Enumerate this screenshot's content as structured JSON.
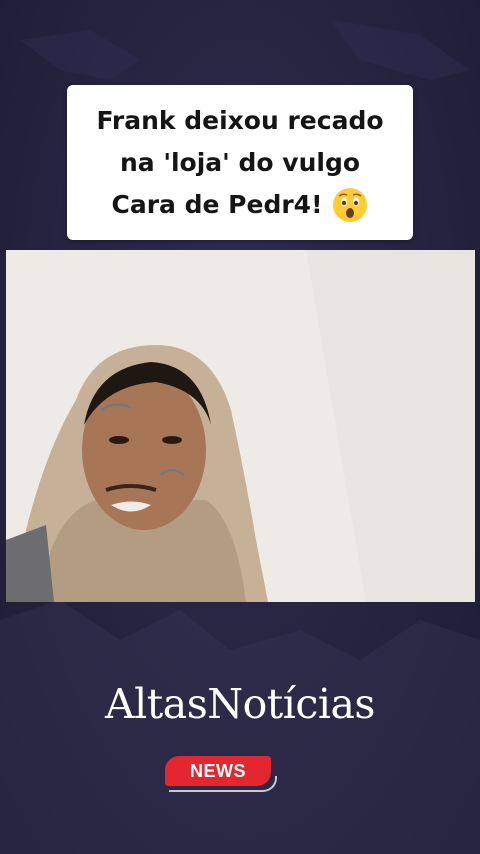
{
  "headline": {
    "line1": "Frank deixou recado",
    "line2": "na 'loja' do vulgo",
    "line3": "Cara de Pedr4!",
    "emoji": "astonished-face-emoji"
  },
  "video": {
    "subject": "person-in-hoodie-video-frame"
  },
  "brand": {
    "name": "AltasNotícias",
    "badge": "NEWS"
  },
  "colors": {
    "background": "#25233f",
    "badge_red": "#e3262f",
    "card_white": "#ffffff"
  }
}
